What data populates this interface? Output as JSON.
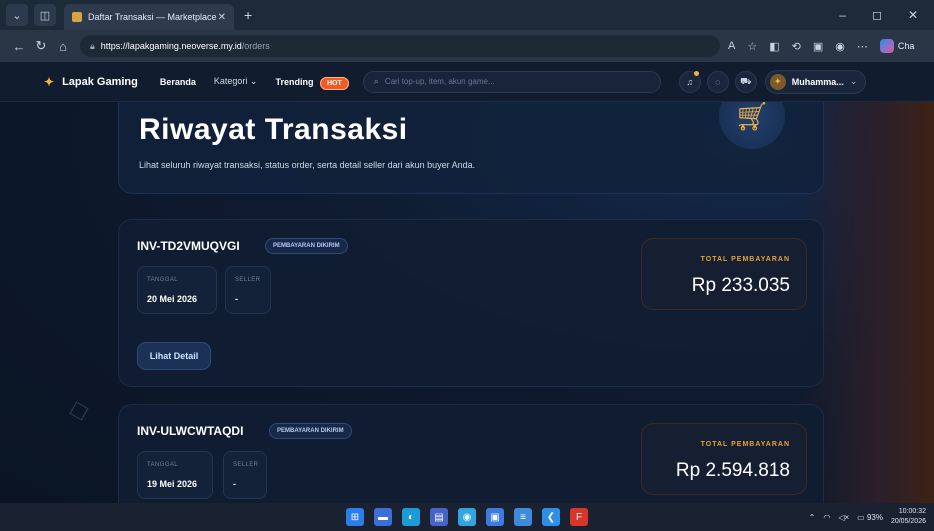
{
  "browser": {
    "tab_title": "Daftar Transaksi — Marketplace G",
    "tab_close": "✕",
    "new_tab": "+",
    "url_host": "https://lapakgaming.neoverse.my.id",
    "url_path": "/orders",
    "copilot_label": "Cha",
    "window_controls": [
      "–",
      "◻",
      "✕"
    ]
  },
  "site": {
    "brand": "Lapak Gaming",
    "nav": {
      "beranda": "Beranda",
      "kategori": "Kategori",
      "trending": "Trending",
      "hot_badge": "HOT"
    },
    "search_placeholder": "Cari top-up, item, akun game...",
    "user_name": "Muhamma..."
  },
  "hero": {
    "title": "Riwayat Transaksi",
    "subtitle": "Lihat seluruh riwayat transaksi, status order, serta detail seller dari akun buyer Anda."
  },
  "orders": [
    {
      "invoice": "INV-TD2VMUQVGI",
      "status": "PEMBAYARAN DIKIRIM",
      "date_label": "TANGGAL",
      "date": "20 Mei 2026",
      "seller_label": "SELLER",
      "seller": "-",
      "total_label": "TOTAL PEMBAYARAN",
      "total": "Rp 233.035",
      "detail_button": "Lihat Detail"
    },
    {
      "invoice": "INV-ULWCWTAQDI",
      "status": "PEMBAYARAN DIKIRIM",
      "date_label": "TANGGAL",
      "date": "19 Mei 2026",
      "seller_label": "SELLER",
      "seller": "-",
      "total_label": "TOTAL PEMBAYARAN",
      "total": "Rp 2.594.818"
    }
  ],
  "taskbar": {
    "battery": "93%",
    "time": "10:00:32",
    "date": "20/05/2026"
  },
  "colors": {
    "accent_orange": "#e6a13a",
    "hot_badge": "#f15a24",
    "background": "#0d1729"
  }
}
